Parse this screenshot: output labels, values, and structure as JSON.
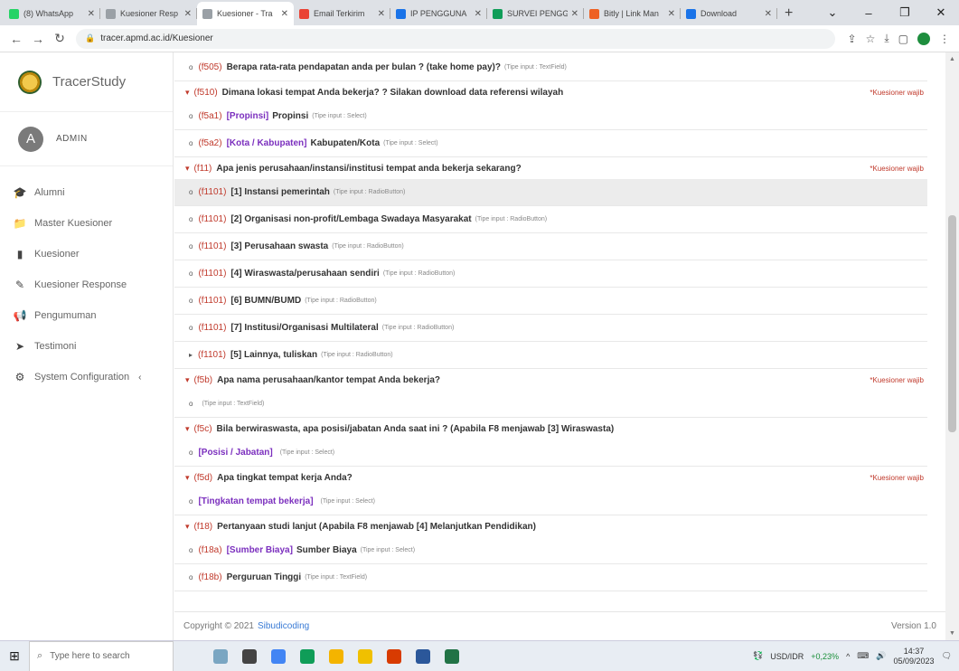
{
  "browser": {
    "tabs": [
      {
        "label": "(8) WhatsApp",
        "color": "#25d366",
        "active": false
      },
      {
        "label": "Kuesioner Resp",
        "color": "#9aa0a6",
        "active": false
      },
      {
        "label": "Kuesioner - Tra",
        "color": "#9aa0a6",
        "active": true
      },
      {
        "label": "Email Terkirim",
        "color": "#ea4335",
        "active": false
      },
      {
        "label": "IP PENGGUNA",
        "color": "#1a73e8",
        "active": false
      },
      {
        "label": "SURVEI PENGG",
        "color": "#0f9d58",
        "active": false
      },
      {
        "label": "Bitly | Link Man",
        "color": "#ee6123",
        "active": false
      },
      {
        "label": "Download",
        "color": "#1a73e8",
        "active": false
      }
    ],
    "new_tab": "+",
    "url": "tracer.apmd.ac.id/Kuesioner"
  },
  "sidebar": {
    "brand": "TracerStudy",
    "user_initial": "A",
    "user_name": "ADMIN",
    "items": [
      {
        "label": "Alumni",
        "icon": "graduation-cap-icon",
        "glyph": "🎓"
      },
      {
        "label": "Master Kuesioner",
        "icon": "folder-icon",
        "glyph": "📁"
      },
      {
        "label": "Kuesioner",
        "icon": "file-icon",
        "glyph": "▮"
      },
      {
        "label": "Kuesioner Response",
        "icon": "edit-icon",
        "glyph": "✎"
      },
      {
        "label": "Pengumuman",
        "icon": "bullhorn-icon",
        "glyph": "📢"
      },
      {
        "label": "Testimoni",
        "icon": "paper-plane-icon",
        "glyph": "➤"
      },
      {
        "label": "System Configuration",
        "icon": "cogs-icon",
        "glyph": "⚙",
        "chevron": "‹"
      }
    ]
  },
  "questions": [
    {
      "kind": "opt",
      "bullet": "o",
      "code": "(f505)",
      "text": "Berapa rata-rata pendapatan anda per bulan ? (take home pay)?",
      "tipe": "(Tipe input : TextField)",
      "top": 0
    },
    {
      "kind": "q",
      "code": "(f510)",
      "text": "Dimana lokasi tempat Anda bekerja? ? Silakan download data referensi wilayah",
      "req": "*Kuesioner wajib"
    },
    {
      "kind": "opt",
      "bullet": "o",
      "code": "(f5a1)",
      "var": "[Propinsi]",
      "text": "Propinsi",
      "tipe": "(Tipe input : Select)"
    },
    {
      "kind": "opt",
      "bullet": "o",
      "code": "(f5a2)",
      "var": "[Kota / Kabupaten]",
      "text": "Kabupaten/Kota",
      "tipe": "(Tipe input : Select)"
    },
    {
      "kind": "q",
      "code": "(f11)",
      "text": "Apa jenis perusahaan/instansi/institusi tempat anda bekerja sekarang?",
      "req": "*Kuesioner wajib"
    },
    {
      "kind": "opt",
      "bullet": "o",
      "code": "(f1101)",
      "text": "[1] Instansi pemerintah",
      "tipe": "(Tipe input : RadioButton)",
      "hl": true
    },
    {
      "kind": "opt",
      "bullet": "o",
      "code": "(f1101)",
      "text": "[2] Organisasi non-profit/Lembaga Swadaya Masyarakat",
      "tipe": "(Tipe input : RadioButton)"
    },
    {
      "kind": "opt",
      "bullet": "o",
      "code": "(f1101)",
      "text": "[3] Perusahaan swasta",
      "tipe": "(Tipe input : RadioButton)"
    },
    {
      "kind": "opt",
      "bullet": "o",
      "code": "(f1101)",
      "text": "[4] Wiraswasta/perusahaan sendiri",
      "tipe": "(Tipe input : RadioButton)"
    },
    {
      "kind": "opt",
      "bullet": "o",
      "code": "(f1101)",
      "text": "[6] BUMN/BUMD",
      "tipe": "(Tipe input : RadioButton)"
    },
    {
      "kind": "opt",
      "bullet": "o",
      "code": "(f1101)",
      "text": "[7] Institusi/Organisasi Multilateral",
      "tipe": "(Tipe input : RadioButton)"
    },
    {
      "kind": "opt",
      "bullet": "▸",
      "code": "(f1101)",
      "text": "[5] Lainnya, tuliskan",
      "tipe": "(Tipe input : RadioButton)"
    },
    {
      "kind": "q",
      "code": "(f5b)",
      "text": "Apa nama perusahaan/kantor tempat Anda bekerja?",
      "req": "*Kuesioner wajib"
    },
    {
      "kind": "opt",
      "bullet": "o",
      "tipe": "(Tipe input : TextField)"
    },
    {
      "kind": "q",
      "code": "(f5c)",
      "text": "Bila berwiraswasta, apa posisi/jabatan Anda saat ini ? (Apabila F8 menjawab [3] Wiraswasta)"
    },
    {
      "kind": "opt",
      "bullet": "o",
      "var": "[Posisi / Jabatan]",
      "tipe": "(Tipe input : Select)"
    },
    {
      "kind": "q",
      "code": "(f5d)",
      "text": "Apa tingkat tempat kerja Anda?",
      "req": "*Kuesioner wajib"
    },
    {
      "kind": "opt",
      "bullet": "o",
      "var": "[Tingkatan tempat bekerja]",
      "tipe": "(Tipe input : Select)"
    },
    {
      "kind": "q",
      "code": "(f18)",
      "text": "Pertanyaan studi lanjut (Apabila F8 menjawab [4] Melanjutkan Pendidikan)"
    },
    {
      "kind": "opt",
      "bullet": "o",
      "code": "(f18a)",
      "var": "[Sumber Biaya]",
      "text": "Sumber Biaya",
      "tipe": "(Tipe input : Select)"
    },
    {
      "kind": "opt",
      "bullet": "o",
      "code": "(f18b)",
      "text": "Perguruan Tinggi",
      "tipe": "(Tipe input : TextField)"
    }
  ],
  "footer": {
    "copyright": "Copyright © 2021",
    "by": "Sibudicoding",
    "version": "Version 1.0"
  },
  "taskbar": {
    "search_placeholder": "Type here to search",
    "ticker": "USD/IDR",
    "change": "+0,23%",
    "time": "14:37",
    "date": "05/09/2023",
    "apps": [
      "#7aa6c2",
      "#444444",
      "#4285f4",
      "#0f9d58",
      "#f4b400",
      "#f0c000",
      "#d83b01",
      "#2b579a",
      "#217346"
    ]
  }
}
